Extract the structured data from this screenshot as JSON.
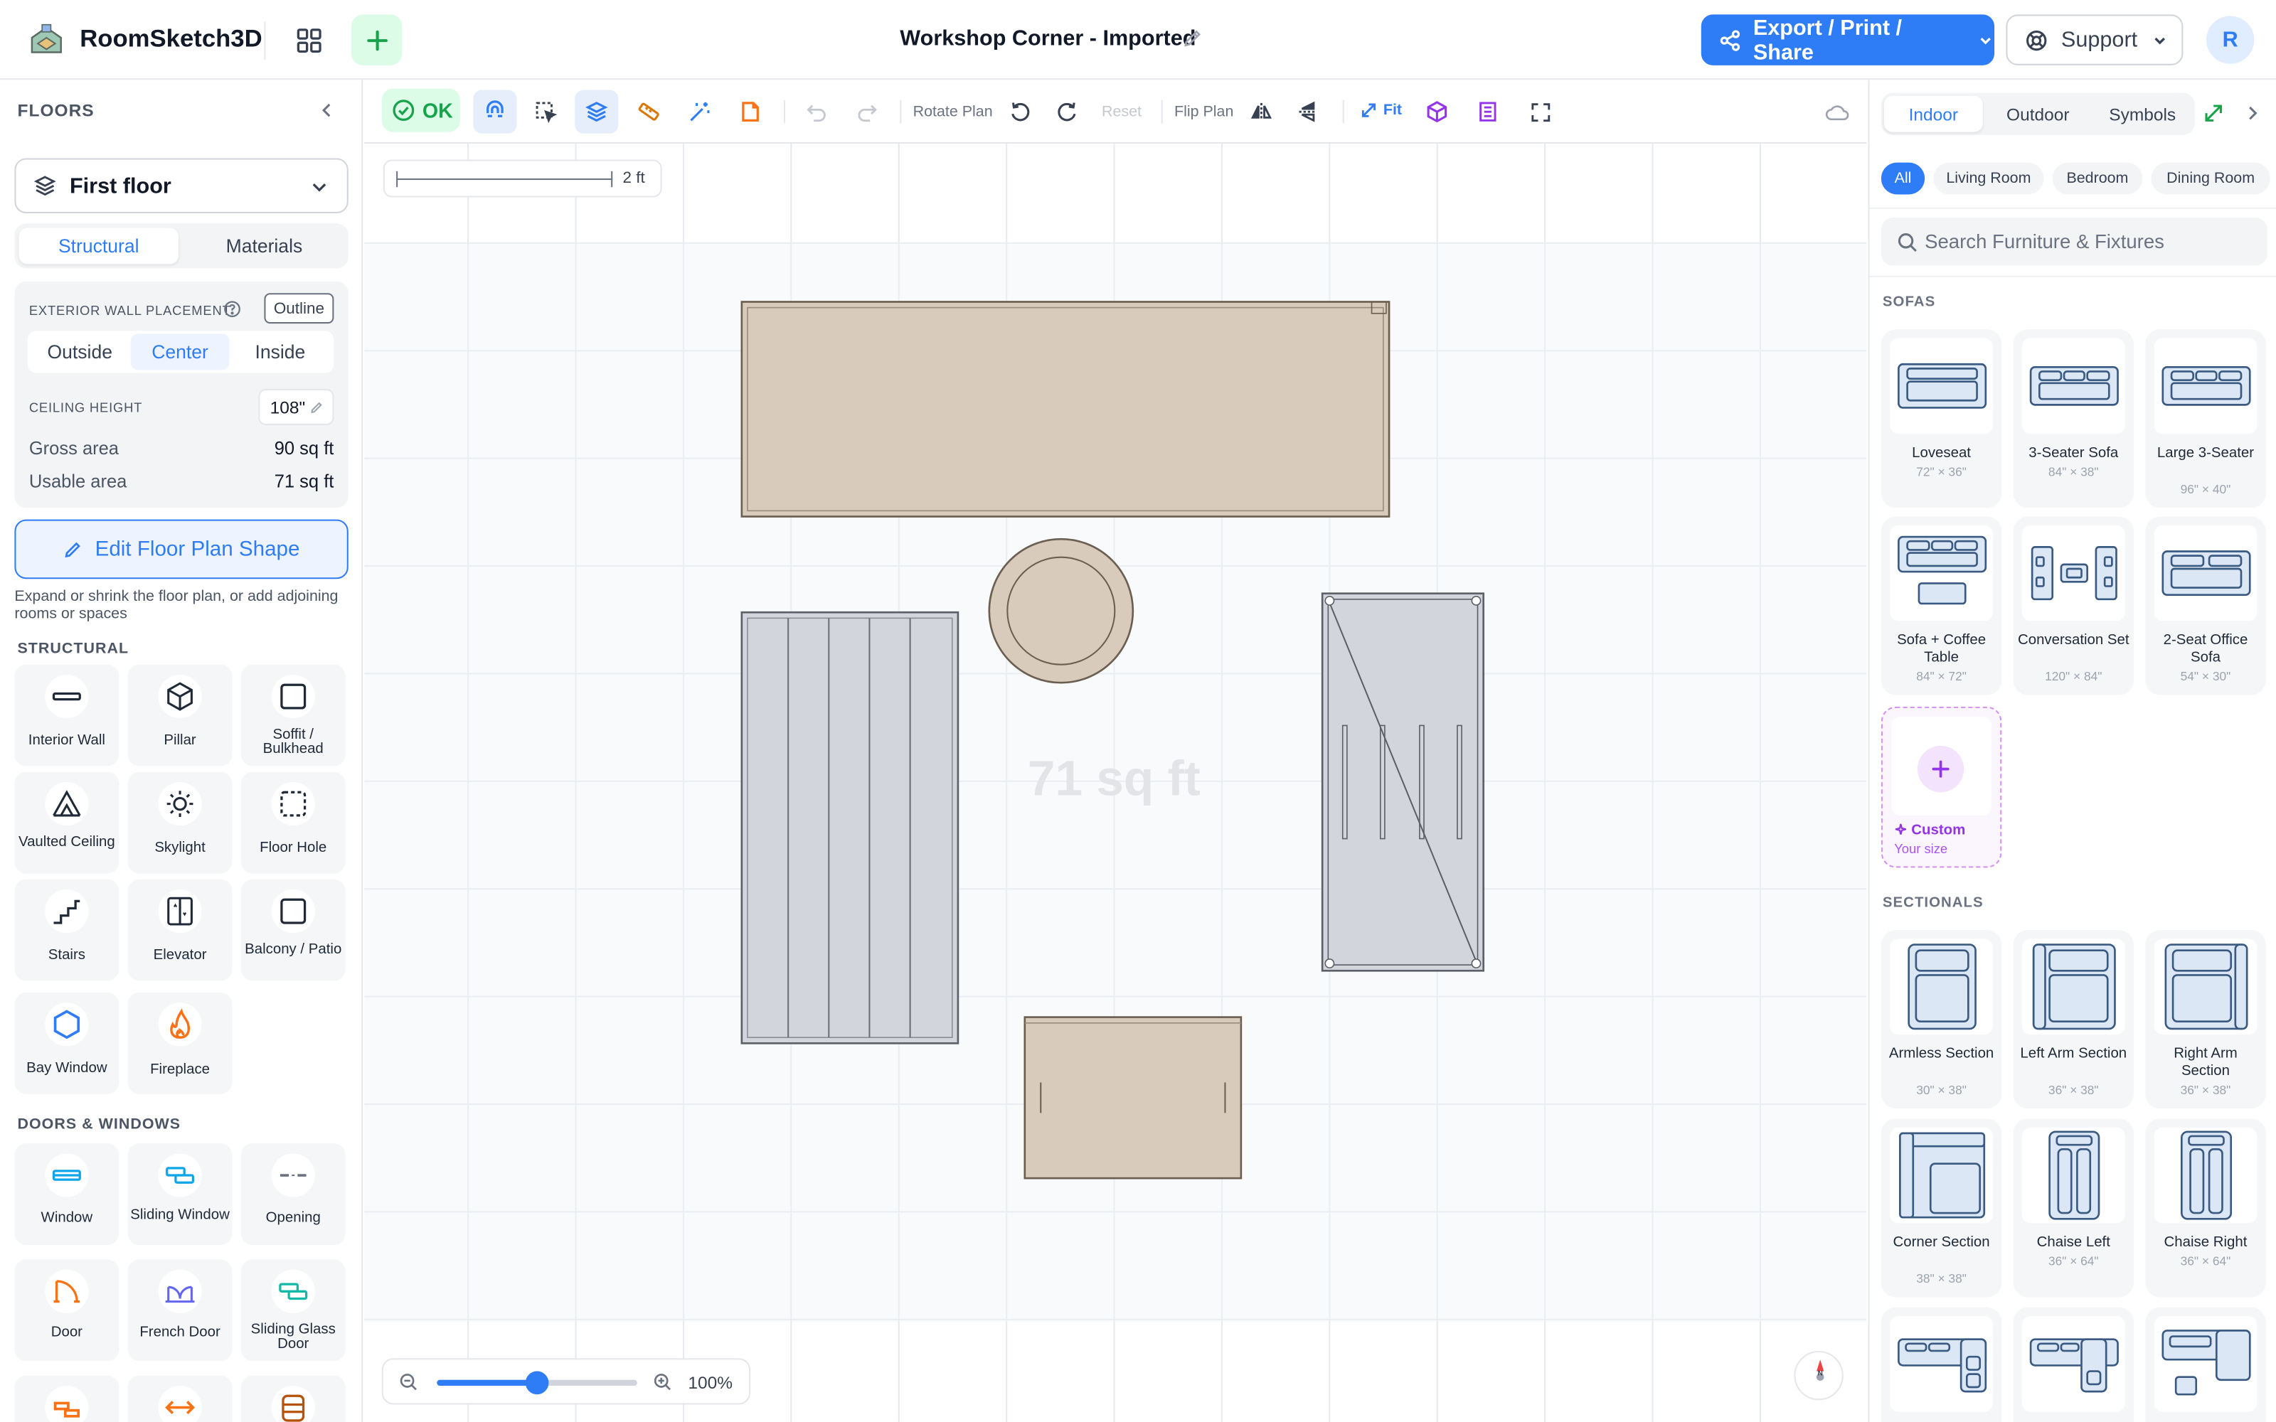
{
  "header": {
    "app_name": "RoomSketch3D",
    "project_title": "Workshop Corner - Imported",
    "export_label": "Export / Print / Share",
    "support_label": "Support",
    "avatar_initial": "R",
    "accent": "#2e7df6"
  },
  "left": {
    "floors_title": "FLOORS",
    "floor_selected": "First floor",
    "tabs": {
      "structural": "Structural",
      "materials": "Materials",
      "active": "structural"
    },
    "exterior_wall_placement": "EXTERIOR WALL PLACEMENT",
    "outline_label": "Outline",
    "placement_options": [
      "Outside",
      "Center",
      "Inside"
    ],
    "placement_active": "Center",
    "ceiling_height_label": "CEILING HEIGHT",
    "ceiling_height_value": "108\"",
    "gross_area_label": "Gross area",
    "gross_area_value": "90 sq ft",
    "usable_area_label": "Usable area",
    "usable_area_value": "71 sq ft",
    "edit_floor_plan": "Edit Floor Plan Shape",
    "edit_hint": "Expand or shrink the floor plan, or add adjoining rooms or spaces",
    "structural_title": "STRUCTURAL",
    "structural_tools": [
      {
        "label": "Interior Wall",
        "icon": "interior-wall-icon"
      },
      {
        "label": "Pillar",
        "icon": "pillar-icon"
      },
      {
        "label": "Soffit / Bulkhead",
        "icon": "soffit-icon"
      },
      {
        "label": "Vaulted Ceiling",
        "icon": "vaulted-ceiling-icon"
      },
      {
        "label": "Skylight",
        "icon": "skylight-icon"
      },
      {
        "label": "Floor Hole",
        "icon": "floor-hole-icon"
      },
      {
        "label": "Stairs",
        "icon": "stairs-icon"
      },
      {
        "label": "Elevator",
        "icon": "elevator-icon"
      },
      {
        "label": "Balcony / Patio",
        "icon": "balcony-icon"
      },
      {
        "label": "Bay Window",
        "icon": "bay-window-icon"
      },
      {
        "label": "Fireplace",
        "icon": "fireplace-icon"
      }
    ],
    "doors_title": "DOORS & WINDOWS",
    "door_tools": [
      {
        "label": "Window",
        "icon": "window-icon"
      },
      {
        "label": "Sliding Window",
        "icon": "sliding-window-icon"
      },
      {
        "label": "Opening",
        "icon": "opening-icon"
      },
      {
        "label": "Door",
        "icon": "door-icon"
      },
      {
        "label": "French Door",
        "icon": "french-door-icon"
      },
      {
        "label": "Sliding Glass Door",
        "icon": "sliding-glass-door-icon"
      }
    ]
  },
  "toolbar": {
    "ok_label": "OK",
    "rotate_plan": "Rotate Plan",
    "reset": "Reset",
    "flip_plan": "Flip Plan",
    "fit": "Fit"
  },
  "canvas": {
    "scale_label": "2 ft",
    "area_watermark": "71 sq ft",
    "zoom_value": "100%",
    "zoom_level": 0.5,
    "compass_label": "N"
  },
  "right": {
    "tabs": [
      "Indoor",
      "Outdoor",
      "Symbols"
    ],
    "active_tab": "Indoor",
    "categories": [
      "All",
      "Living Room",
      "Bedroom",
      "Dining Room"
    ],
    "active_category": "All",
    "search_placeholder": "Search Furniture & Fixtures",
    "sofas_title": "SOFAS",
    "sofas": [
      {
        "name": "Loveseat",
        "dims": "72\" × 36\""
      },
      {
        "name": "3-Seater Sofa",
        "dims": "84\" × 38\""
      },
      {
        "name": "Large 3-Seater",
        "dims": "96\" × 40\""
      },
      {
        "name": "Sofa + Coffee Table",
        "dims": "84\" × 72\""
      },
      {
        "name": "Conversation Set",
        "dims": "120\" × 84\""
      },
      {
        "name": "2-Seat Office Sofa",
        "dims": "54\" × 30\""
      }
    ],
    "custom_name": "Custom",
    "custom_dims": "Your size",
    "sectionals_title": "SECTIONALS",
    "sectionals": [
      {
        "name": "Armless Section",
        "dims": "30\" × 38\""
      },
      {
        "name": "Left Arm Section",
        "dims": "36\" × 38\""
      },
      {
        "name": "Right Arm Section",
        "dims": "36\" × 38\""
      },
      {
        "name": "Corner Section",
        "dims": "38\" × 38\""
      },
      {
        "name": "Chaise Left",
        "dims": "36\" × 64\""
      },
      {
        "name": "Chaise Right",
        "dims": "36\" × 64\""
      }
    ]
  }
}
